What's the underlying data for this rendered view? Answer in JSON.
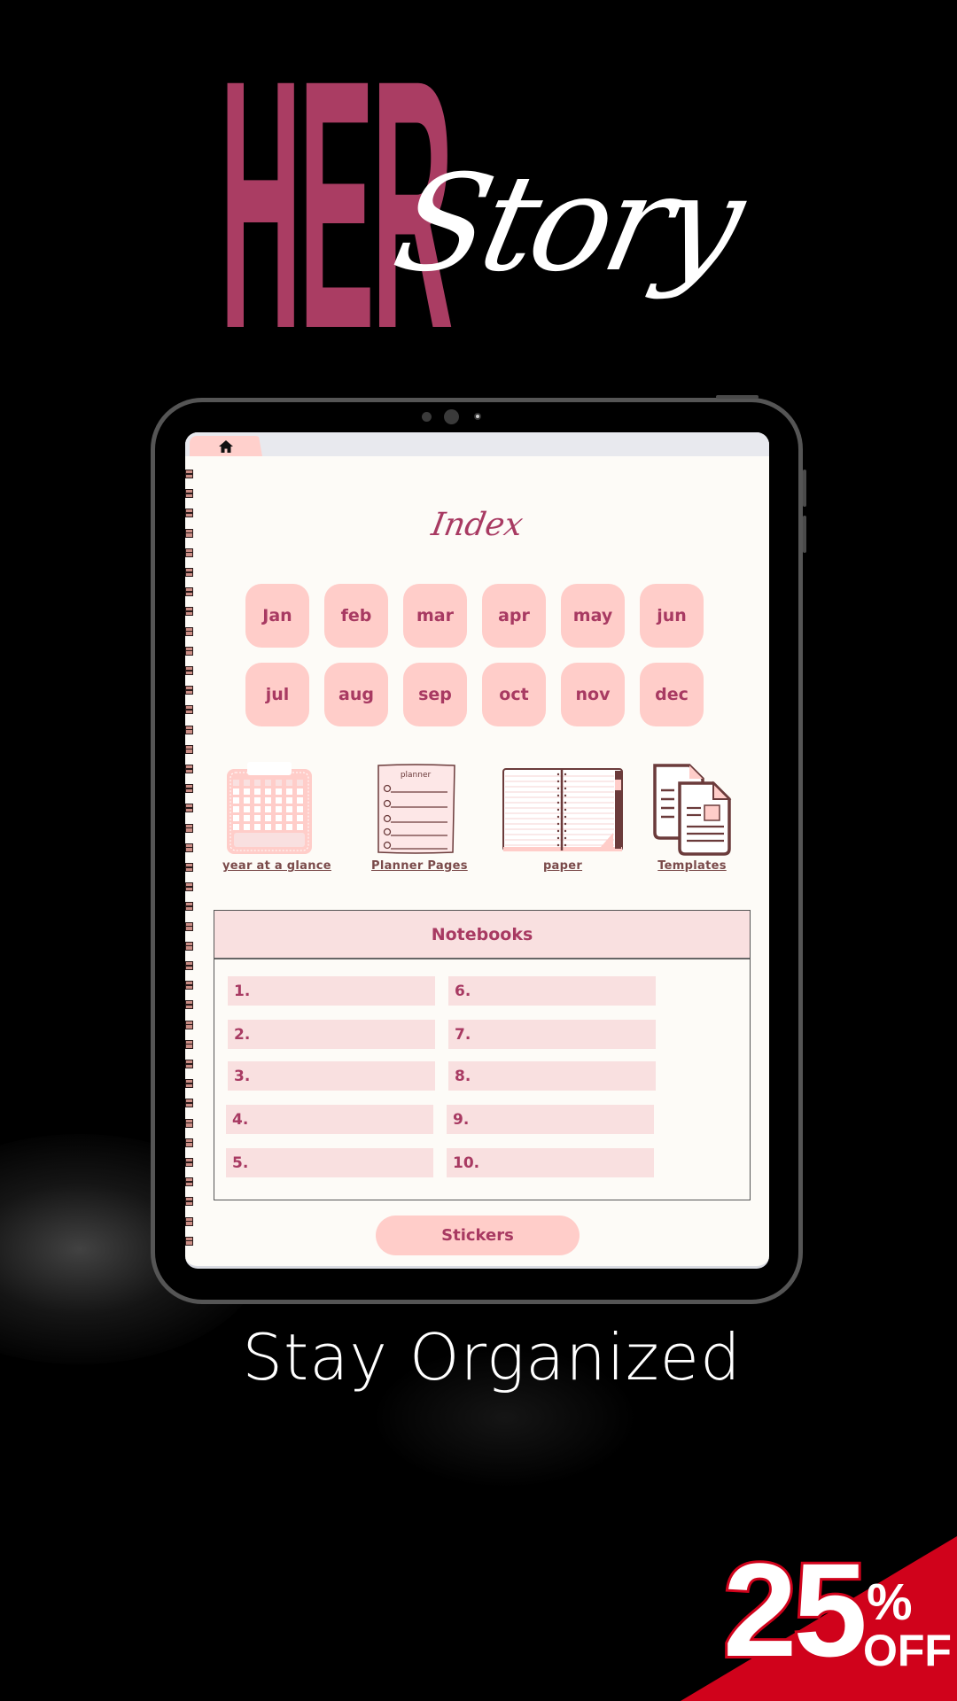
{
  "hero": {
    "title_bold": "HER",
    "title_script": "Story"
  },
  "tablet": {
    "tab_bar": {
      "tabs": [
        {
          "icon": "home-icon",
          "active": true
        }
      ]
    },
    "page": {
      "title": "Index",
      "months": [
        "Jan",
        "feb",
        "mar",
        "apr",
        "may",
        "jun",
        "jul",
        "aug",
        "sep",
        "oct",
        "nov",
        "dec"
      ],
      "shortcuts": [
        {
          "label": "year at a glance",
          "icon": "calendar-icon"
        },
        {
          "label": "Planner Pages",
          "icon": "checklist-icon"
        },
        {
          "label": "paper",
          "icon": "open-notebook-icon"
        },
        {
          "label": "Templates",
          "icon": "documents-icon"
        }
      ],
      "notebooks": {
        "title": "Notebooks",
        "items": [
          "1.",
          "2.",
          "3.",
          "4.",
          "5.",
          "6.",
          "7.",
          "8.",
          "9.",
          "10."
        ]
      },
      "stickers_label": "Stickers"
    }
  },
  "tagline": "Stay Organized",
  "promo": {
    "number": "25",
    "percent": "%",
    "off": "OFF"
  },
  "colors": {
    "brand_rose": "#aa3d63",
    "label_rose": "#a83a62",
    "button_pink": "#ffcdc9",
    "row_pink": "#f9e0e0",
    "paper": "#fdfbf7",
    "promo_red": "#d0021b"
  }
}
